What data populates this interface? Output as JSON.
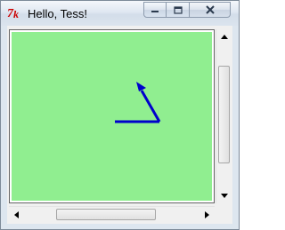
{
  "window": {
    "title": "Hello, Tess!",
    "app_icon": "tk-feather-icon"
  },
  "title_buttons": {
    "minimize": "minimize-icon",
    "maximize": "maximize-icon",
    "close": "close-icon"
  },
  "canvas": {
    "background": "#90ee90",
    "turtle": {
      "color": "#0000cc"
    }
  },
  "scrollbars": {
    "vertical": {
      "position": 0.21
    },
    "horizontal": {
      "position": 0.3
    }
  }
}
